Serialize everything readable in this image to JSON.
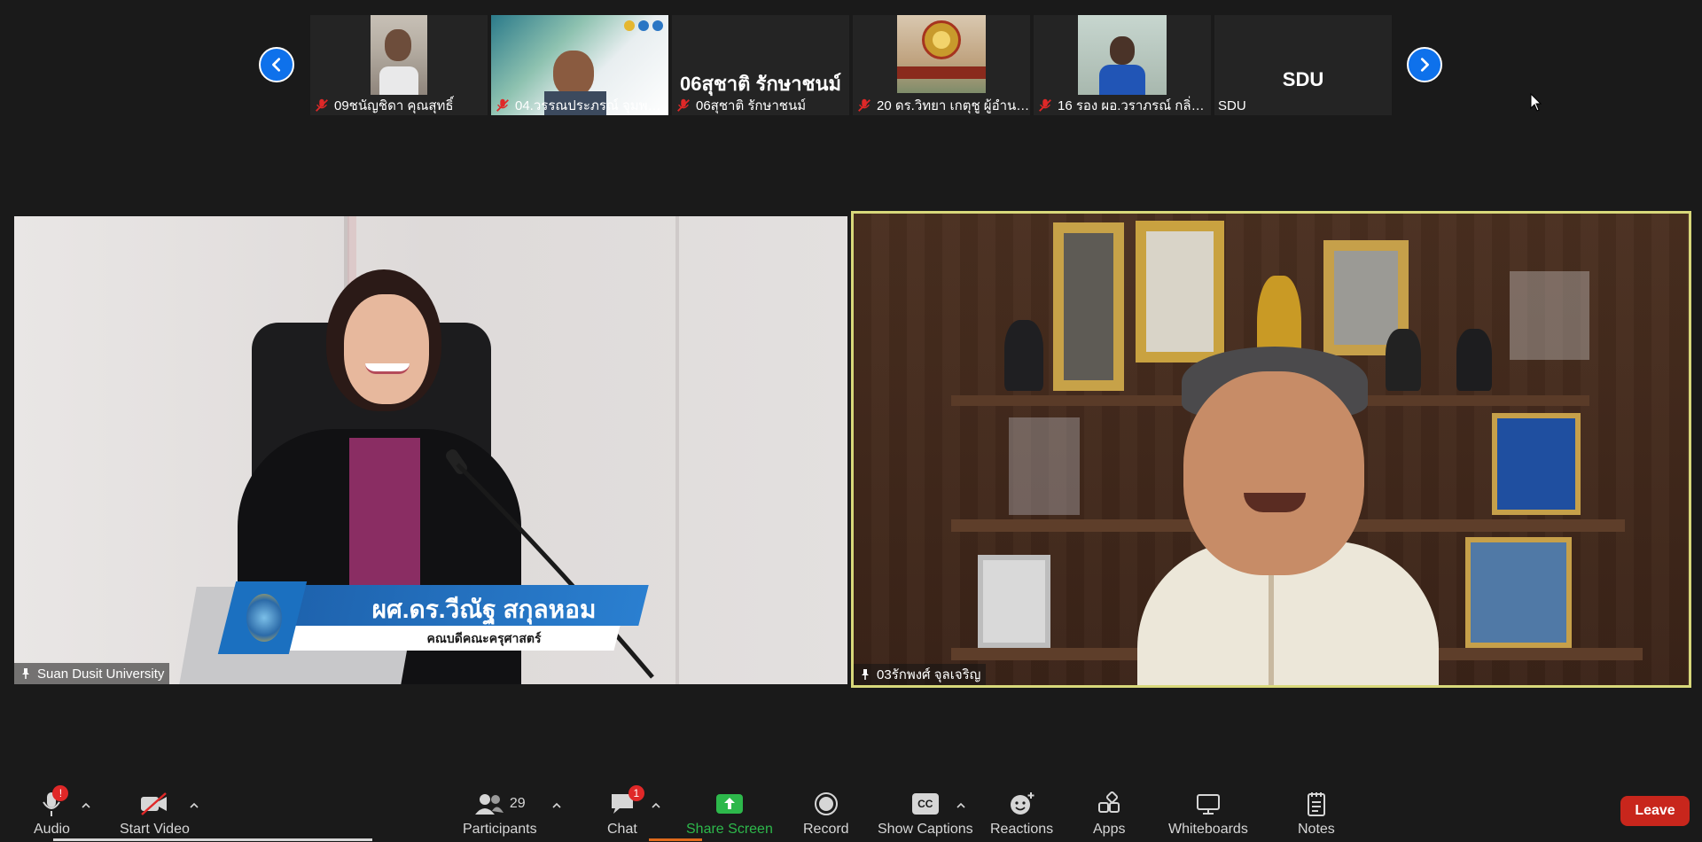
{
  "strip": {
    "participants": [
      {
        "name": "09ชนัญชิดา  คุณสุทธิ์",
        "big_name": ""
      },
      {
        "name": "04.วรรณประภรณ์ จุมพลน้...",
        "big_name": ""
      },
      {
        "name": "06สุชาติ รักษาชนม์",
        "big_name": "06สุชาติ รักษาชนม์"
      },
      {
        "name": "20 ดร.วิทยา เกตุชู ผู้อำนว...",
        "big_name": ""
      },
      {
        "name": "16 รอง ผอ.วราภรณ์ กลิ่นเ...",
        "big_name": ""
      },
      {
        "name": "SDU",
        "big_name": "SDU"
      }
    ]
  },
  "main": {
    "left_tile": {
      "label": "Suan Dusit University",
      "banner_name": "ผศ.ดร.วีณัฐ สกุลหอม",
      "banner_title": "คณบดีคณะครุศาสตร์"
    },
    "right_tile": {
      "label": "03รักพงศ์ จุลเจริญ"
    }
  },
  "toolbar": {
    "audio": {
      "label": "Audio",
      "badge": "!"
    },
    "video": {
      "label": "Start Video"
    },
    "participants": {
      "label": "Participants",
      "count": "29"
    },
    "chat": {
      "label": "Chat",
      "badge": "1"
    },
    "share": {
      "label": "Share Screen"
    },
    "record": {
      "label": "Record"
    },
    "captions": {
      "label": "Show Captions",
      "icon_text": "CC"
    },
    "reactions": {
      "label": "Reactions"
    },
    "apps": {
      "label": "Apps"
    },
    "whiteboards": {
      "label": "Whiteboards"
    },
    "notes": {
      "label": "Notes"
    },
    "leave": {
      "label": "Leave"
    }
  },
  "colors": {
    "accent_blue": "#0e71eb",
    "share_green": "#2db84b",
    "leave_red": "#c8261c",
    "speaker_border": "#d8d87a",
    "badge_red": "#e02828"
  }
}
